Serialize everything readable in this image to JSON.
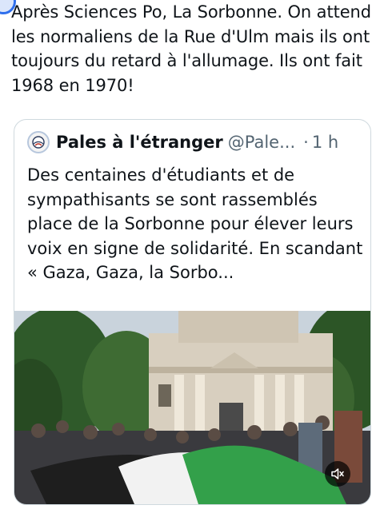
{
  "post": {
    "text": "Après Sciences Po, La Sorbonne. On attend les normaliens de la Rue d'Ulm mais ils ont toujours du retard à l'allumage. Ils ont fait 1968 en 1970!"
  },
  "quote": {
    "name": "Pales à l'étranger",
    "handle": "@Pale...",
    "separator": "·",
    "time": "1 h",
    "text": "Des centaines d'étudiants et de sympathisants se sont rassemblés place de la Sorbonne pour élever leurs voix en signe de solidarité. En scandant « Gaza, Gaza, la Sorbo..."
  },
  "icons": {
    "quote_avatar": "globe-logo-icon",
    "audio": "speaker-muted-icon"
  }
}
